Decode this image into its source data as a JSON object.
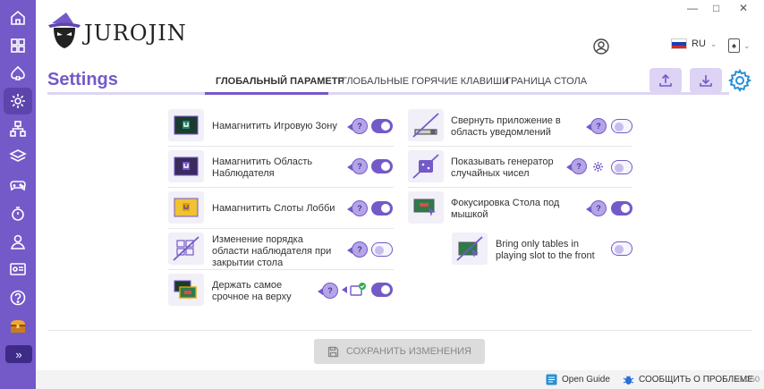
{
  "app": {
    "logo_text": "JUROJIN"
  },
  "window": {
    "controls": [
      "—",
      "□",
      "✕"
    ]
  },
  "header": {
    "language": "RU"
  },
  "page": {
    "title": "Settings"
  },
  "tabs": [
    {
      "label": "ГЛОБАЛЬНЫЙ ПАРАМЕТР",
      "active": true
    },
    {
      "label": "ГЛОБАЛЬНЫЕ ГОРЯЧИЕ КЛАВИШИ",
      "active": false
    },
    {
      "label": "ГРАНИЦА СТОЛА",
      "active": false
    }
  ],
  "settings_left": [
    {
      "label": "Намагнитить Игровую Зону",
      "help": "?",
      "enabled": true
    },
    {
      "label": "Намагнитить Область Наблюдателя",
      "help": "?",
      "enabled": true
    },
    {
      "label": "Намагнитить Слоты Лобби",
      "help": "?",
      "enabled": true
    },
    {
      "label": "Изменение порядка области наблюдателя при закрытии стола",
      "help": "?",
      "enabled": false
    },
    {
      "label": "Держать самое срочное на верху",
      "help": "?",
      "enabled": true
    }
  ],
  "settings_right": [
    {
      "label": "Свернуть приложение в область уведомлений",
      "help": "?",
      "enabled": false
    },
    {
      "label": "Показывать генератор случайных чисел",
      "help": "?",
      "enabled": false
    },
    {
      "label": "Фокусировка Стола под мышкой",
      "help": "?",
      "enabled": true
    },
    {
      "label": "Bring only tables in playing slot to the front",
      "enabled": false
    }
  ],
  "actions": {
    "save_label": "СОХРАНИТЬ ИЗМЕНЕНИЯ"
  },
  "footer": {
    "guide_label": "Open Guide",
    "report_label": "СООБЩИТЬ О ПРОБЛЕМЕ",
    "version": "v1.350"
  },
  "colors": {
    "accent": "#7459c9",
    "sidebar": "#7459c9",
    "accent_light": "#dcd3f5"
  }
}
